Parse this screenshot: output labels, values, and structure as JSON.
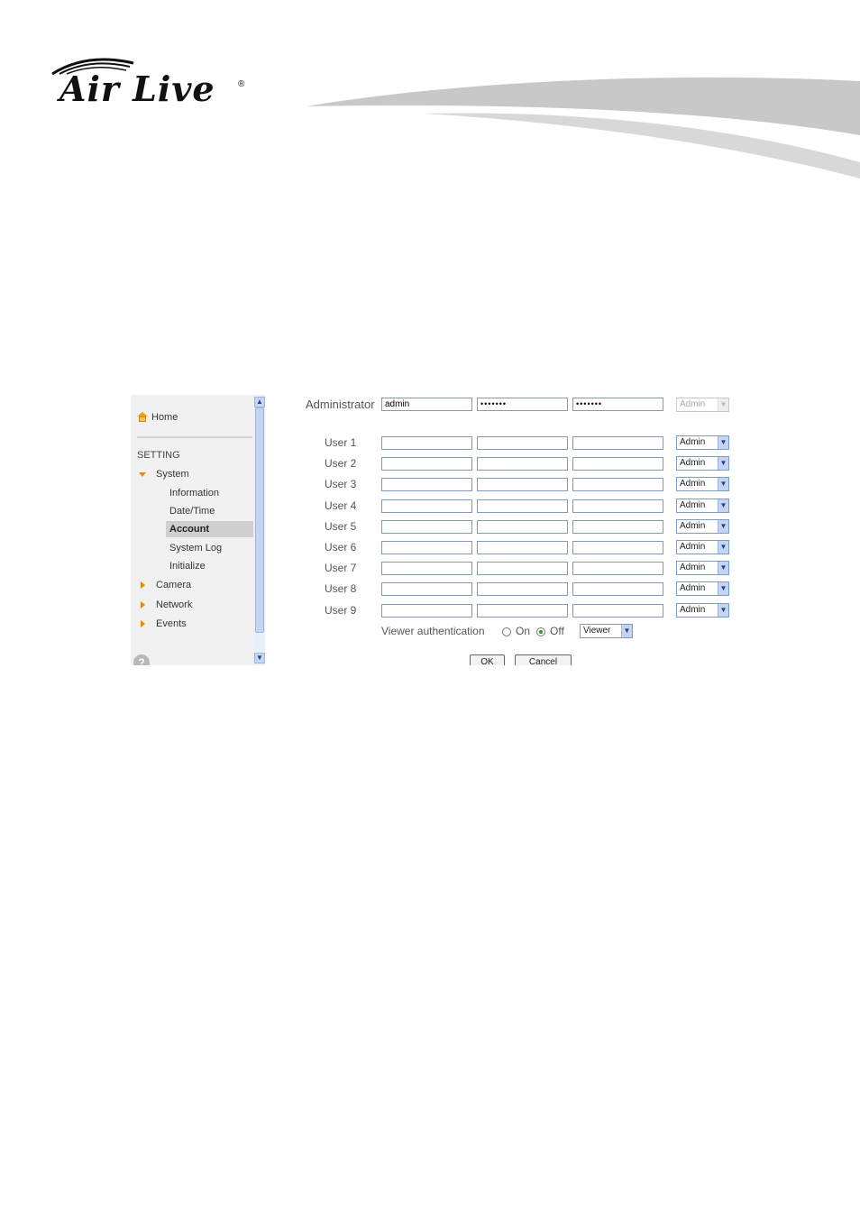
{
  "brand": {
    "logo_text": "Air Live",
    "registered": "®"
  },
  "sidebar": {
    "home_label": "Home",
    "section_label": "SETTING",
    "items": [
      {
        "label": "System"
      },
      {
        "label": "Information"
      },
      {
        "label": "Date/Time"
      },
      {
        "label": "Account"
      },
      {
        "label": "System Log"
      },
      {
        "label": "Initialize"
      },
      {
        "label": "Camera"
      },
      {
        "label": "Network"
      },
      {
        "label": "Events"
      }
    ],
    "help_icon": "?"
  },
  "account": {
    "admin": {
      "label": "Administrator",
      "username": "admin",
      "password": "•••••••",
      "confirm": "•••••••",
      "role": "Admin"
    },
    "users": [
      {
        "label": "User 1",
        "username": "",
        "password": "",
        "confirm": "",
        "role": "Admin"
      },
      {
        "label": "User 2",
        "username": "",
        "password": "",
        "confirm": "",
        "role": "Admin"
      },
      {
        "label": "User 3",
        "username": "",
        "password": "",
        "confirm": "",
        "role": "Admin"
      },
      {
        "label": "User 4",
        "username": "",
        "password": "",
        "confirm": "",
        "role": "Admin"
      },
      {
        "label": "User 5",
        "username": "",
        "password": "",
        "confirm": "",
        "role": "Admin"
      },
      {
        "label": "User 6",
        "username": "",
        "password": "",
        "confirm": "",
        "role": "Admin"
      },
      {
        "label": "User 7",
        "username": "",
        "password": "",
        "confirm": "",
        "role": "Admin"
      },
      {
        "label": "User 8",
        "username": "",
        "password": "",
        "confirm": "",
        "role": "Admin"
      },
      {
        "label": "User 9",
        "username": "",
        "password": "",
        "confirm": "",
        "role": "Admin"
      }
    ],
    "viewer_auth": {
      "label": "Viewer authentication",
      "on_label": "On",
      "off_label": "Off",
      "selected": "Off",
      "role": "Viewer"
    },
    "ok_label": "OK",
    "cancel_label": "Cancel"
  },
  "colors": {
    "accent_orange": "#e08a10",
    "field_border": "#7f9db9",
    "selected_bg": "#cfcfcf"
  }
}
